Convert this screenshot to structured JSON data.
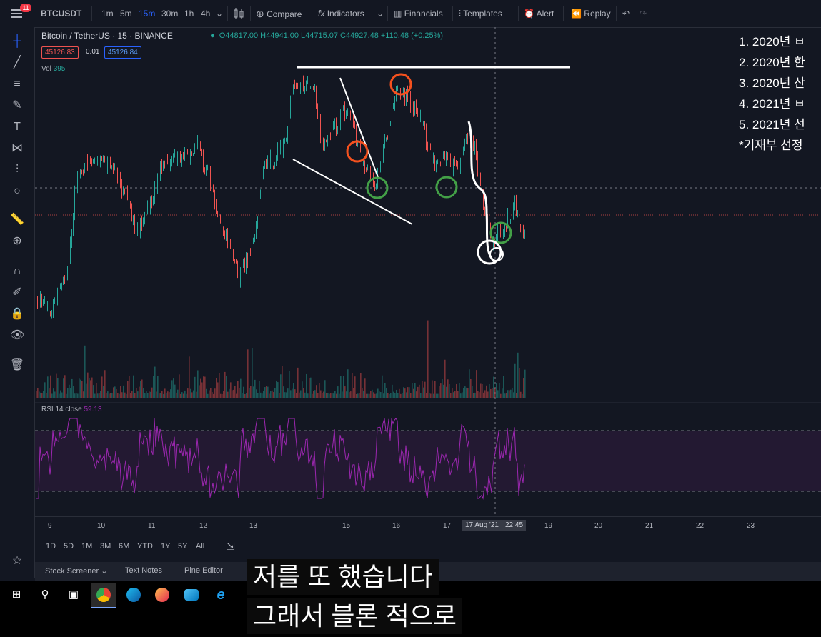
{
  "symbol": "BTCUSDT",
  "timeframes": [
    "1m",
    "5m",
    "15m",
    "30m",
    "1h",
    "4h"
  ],
  "active_timeframe": "15m",
  "toolbar": {
    "compare": "Compare",
    "indicators": "Indicators",
    "financials": "Financials",
    "templates": "Templates",
    "alert": "Alert",
    "replay": "Replay"
  },
  "menu_badge": "11",
  "legend": {
    "title": "Bitcoin / TetherUS · 15 · BINANCE",
    "open": "O44817.00",
    "high": "H44941.00",
    "low": "L44715.07",
    "close": "C44927.48",
    "change": "+110.48 (+0.25%)",
    "bid": "45126.83",
    "spread": "0.01",
    "ask": "45126.84",
    "vol_label": "Vol",
    "vol_value": "395"
  },
  "rsi": {
    "label": "RSI 14 close",
    "value": "59.13"
  },
  "time_axis": [
    "9",
    "10",
    "11",
    "12",
    "13",
    "15",
    "16",
    "17",
    "17 Aug '21",
    "22:45",
    "19",
    "20",
    "21",
    "22",
    "23"
  ],
  "ranges": [
    "1D",
    "5D",
    "1M",
    "3M",
    "6M",
    "YTD",
    "1Y",
    "5Y",
    "All"
  ],
  "bottom_tabs": [
    "Stock Screener",
    "Text Notes",
    "Pine Editor"
  ],
  "notes": [
    "1. 2020년 ㅂ",
    "2. 2020년 한",
    "3. 2020년 산",
    "4. 2021년 ㅂ",
    "5. 2021년 선",
    "*기재부 선정"
  ],
  "subtitles": [
    "저를 또 했습니다",
    "그래서 블론 적으로"
  ],
  "colors": {
    "bg": "#131722",
    "up": "#26a69a",
    "down": "#ef5350",
    "rsi": "#9c27b0",
    "accent": "#2962ff"
  }
}
